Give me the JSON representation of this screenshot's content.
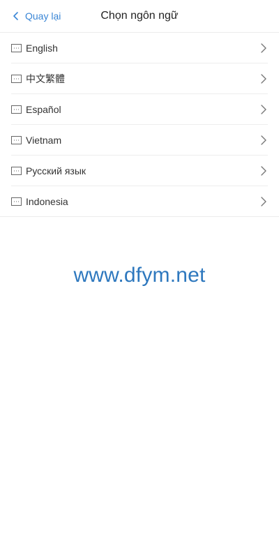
{
  "header": {
    "back_label": "Quay lại",
    "title": "Chọn ngôn ngữ"
  },
  "languages": [
    {
      "label": "English"
    },
    {
      "label": "中文繁體"
    },
    {
      "label": "Español"
    },
    {
      "label": "Vietnam"
    },
    {
      "label": "Русский язык"
    },
    {
      "label": "Indonesia"
    }
  ],
  "watermark": "www.dfym.net",
  "colors": {
    "accent": "#3a86d6",
    "watermark": "#2e78be",
    "divider": "#eeeeee"
  },
  "icons": {
    "row_icon": "keyboard-icon",
    "back_icon": "chevron-left-icon",
    "row_arrow": "chevron-right-icon"
  }
}
